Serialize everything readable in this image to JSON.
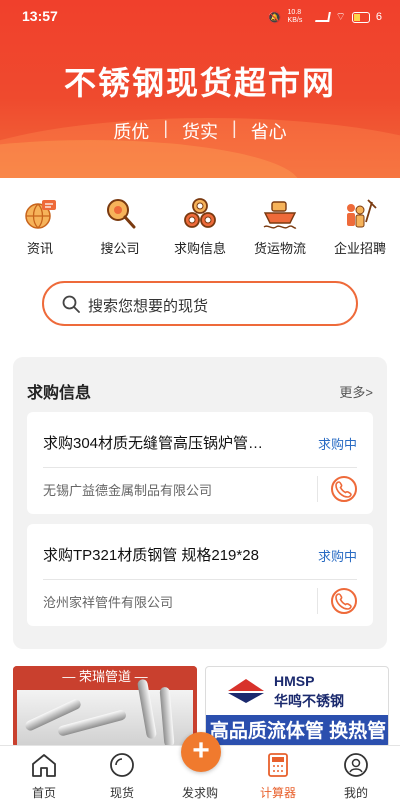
{
  "status_bar": {
    "time": "13:57",
    "battery": "6",
    "net": "10.8 KB/s"
  },
  "banner": {
    "title": "不锈钢现货超市网",
    "slogans": [
      "质优",
      "货实",
      "省心"
    ]
  },
  "categories": [
    {
      "label": "资讯",
      "icon": "globe-news-icon"
    },
    {
      "label": "搜公司",
      "icon": "search-company-icon"
    },
    {
      "label": "求购信息",
      "icon": "steel-pipes-icon"
    },
    {
      "label": "货运物流",
      "icon": "ship-icon"
    },
    {
      "label": "企业招聘",
      "icon": "recruit-people-icon"
    }
  ],
  "search": {
    "placeholder": "搜索您想要的现货"
  },
  "requests": {
    "title": "求购信息",
    "more": "更多>",
    "items": [
      {
        "title": "求购304材质无缝管高压锅炉管…",
        "status": "求购中",
        "company": "无锡广益德金属制品有限公司"
      },
      {
        "title": "求购TP321材质钢管 规格219*28",
        "status": "求购中",
        "company": "沧州家祥管件有限公司"
      }
    ]
  },
  "ads": {
    "left": {
      "title": "荣瑞管道"
    },
    "right": {
      "brand_en": "HMSP",
      "brand_cn": "华鸣不锈钢",
      "slogan": "高品质流体管 换热管"
    }
  },
  "nav": {
    "items": [
      {
        "label": "首页",
        "icon": "home-icon"
      },
      {
        "label": "现货",
        "icon": "circle-search-icon"
      },
      {
        "label": "发求购",
        "icon": "plus-icon"
      },
      {
        "label": "计算器",
        "icon": "calculator-icon"
      },
      {
        "label": "我的",
        "icon": "profile-icon"
      }
    ],
    "active": "计算器"
  },
  "colors": {
    "accent": "#ee6a3a",
    "header": "#f0402c",
    "status_blue": "#2a6cc4",
    "ad_blue": "#2b4fae"
  }
}
